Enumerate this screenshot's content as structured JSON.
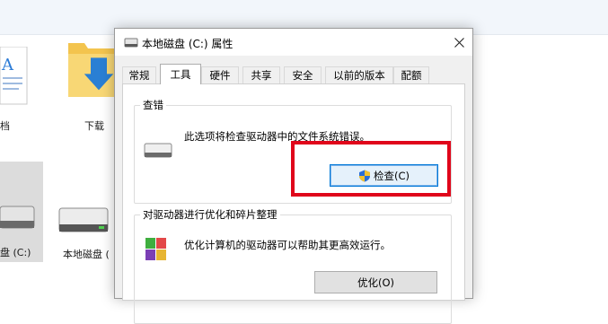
{
  "background": {
    "doc_label": "档",
    "folder_label": "下载",
    "drive_c_label": "盘 (C:)",
    "drive_local_label": "本地磁盘 ("
  },
  "dialog": {
    "title": "本地磁盘 (C:) 属性",
    "tabs": [
      "常规",
      "工具",
      "硬件",
      "共享",
      "安全",
      "以前的版本",
      "配额"
    ],
    "active_tab": "工具",
    "error_check": {
      "title": "查错",
      "description": "此选项将检查驱动器中的文件系统错误。",
      "button_label": "检查(C)"
    },
    "optimize": {
      "title": "对驱动器进行优化和碎片整理",
      "description": "优化计算机的驱动器可以帮助其更高效运行。",
      "button_label": "优化(O)"
    }
  },
  "colors": {
    "highlight": "#e0061b",
    "accent": "#0078d7"
  }
}
